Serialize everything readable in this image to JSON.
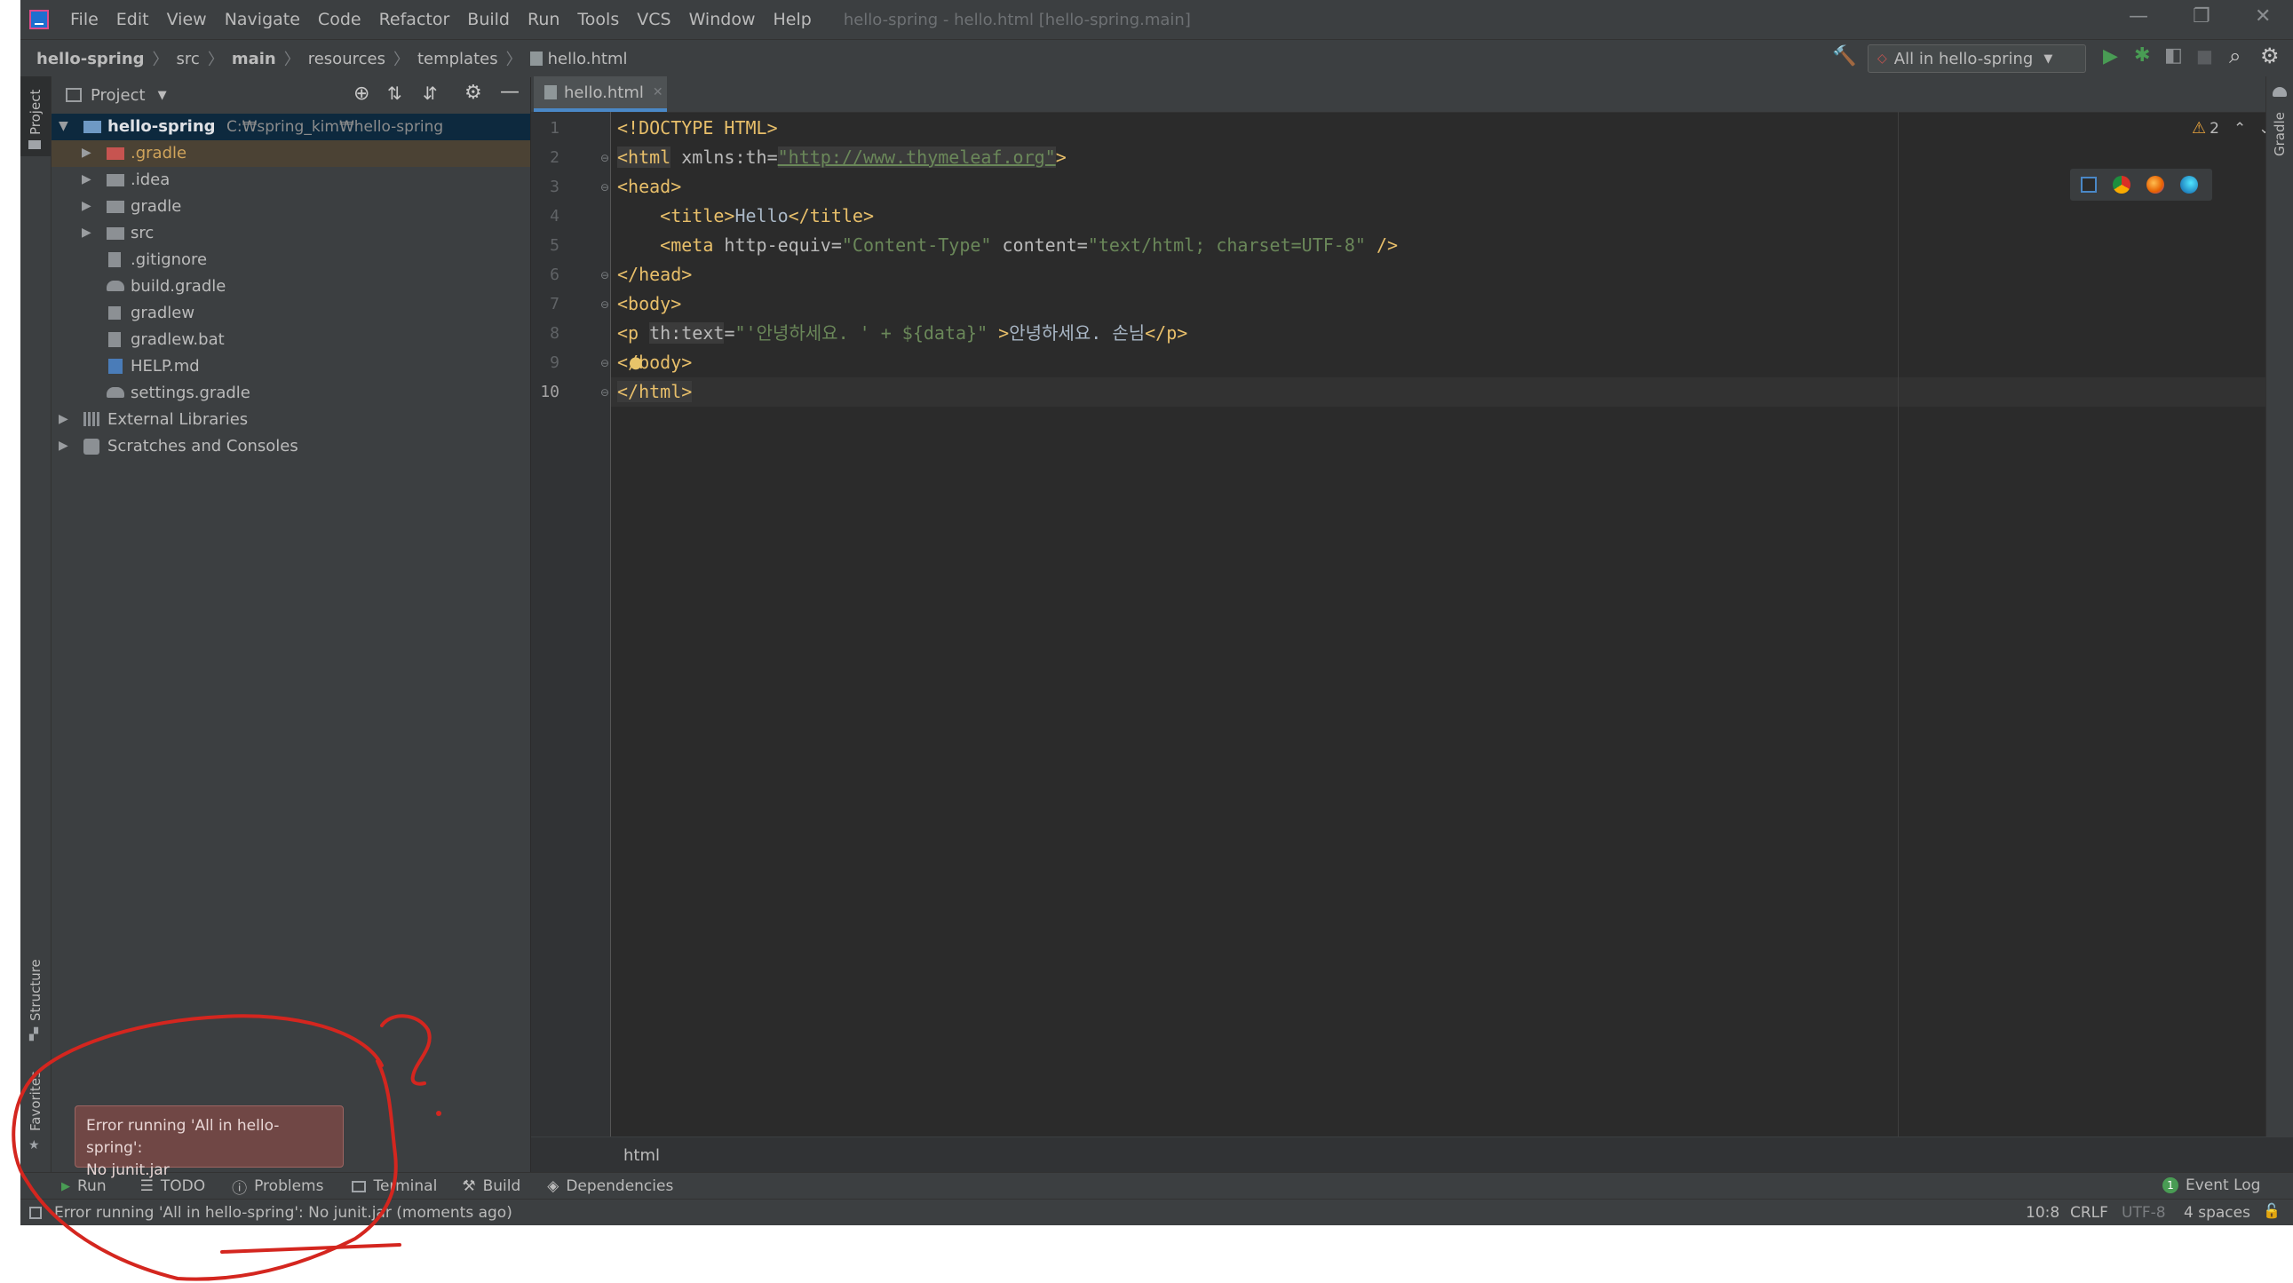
{
  "app": {
    "menu": [
      "File",
      "Edit",
      "View",
      "Navigate",
      "Code",
      "Refactor",
      "Build",
      "Run",
      "Tools",
      "VCS",
      "Window",
      "Help"
    ],
    "window_title": "hello-spring - hello.html [hello-spring.main]"
  },
  "breadcrumb": [
    "hello-spring",
    "src",
    "main",
    "resources",
    "templates",
    "hello.html"
  ],
  "run_config": "All in hello-spring",
  "sidebar": {
    "left_tabs": [
      "Project",
      "Structure",
      "Favorites"
    ],
    "right_tabs": [
      "Gradle"
    ]
  },
  "project": {
    "header": "Project",
    "root_name": "hello-spring",
    "root_path": "C:₩spring_kim₩hello-spring",
    "items": [
      ".gradle",
      ".idea",
      "gradle",
      "src",
      ".gitignore",
      "build.gradle",
      "gradlew",
      "gradlew.bat",
      "HELP.md",
      "settings.gradle"
    ],
    "external": "External Libraries",
    "scratches": "Scratches and Consoles"
  },
  "editor": {
    "tab": "hello.html",
    "line_numbers": [
      "1",
      "2",
      "3",
      "4",
      "5",
      "6",
      "7",
      "8",
      "9",
      "10"
    ],
    "lines": {
      "l1": "<!DOCTYPE HTML>",
      "l2a": "<html",
      "l2b": " xmlns:th=",
      "l2c": "\"http://www.thymeleaf.org\"",
      "l2d": ">",
      "l3": "<head>",
      "l4a": "    <title>",
      "l4b": "Hello",
      "l4c": "</title>",
      "l5a": "    <meta",
      "l5b": " http-equiv=",
      "l5c": "\"Content-Type\"",
      "l5d": " content=",
      "l5e": "\"text/html; charset=UTF-8\"",
      "l5f": " />",
      "l6": "</head>",
      "l7": "<body>",
      "l8a": "<p",
      "l8b": "th:text",
      "l8c": "=",
      "l8d": "\"'안녕하세요. ' + ${data}\"",
      "l8e": " >",
      "l8f": "안녕하세요. 손님",
      "l8g": "</p>",
      "l9": "</body>",
      "l10": "</html>"
    },
    "warnings": "2",
    "footer_crumb": "html"
  },
  "tool_windows": [
    "Run",
    "TODO",
    "Problems",
    "Terminal",
    "Build",
    "Dependencies"
  ],
  "event_log": "Event Log",
  "error_popup": {
    "line1": "Error running 'All in hello-spring':",
    "line2": "No junit.jar"
  },
  "status": {
    "message": "Error running 'All in hello-spring': No junit.jar (moments ago)",
    "position": "10:8",
    "line_sep": "CRLF",
    "encoding": "UTF-8",
    "indent": "4 spaces"
  },
  "colors": {
    "tag": "#e8bf6a",
    "string": "#6a8759",
    "annotation": "#d4261f"
  }
}
